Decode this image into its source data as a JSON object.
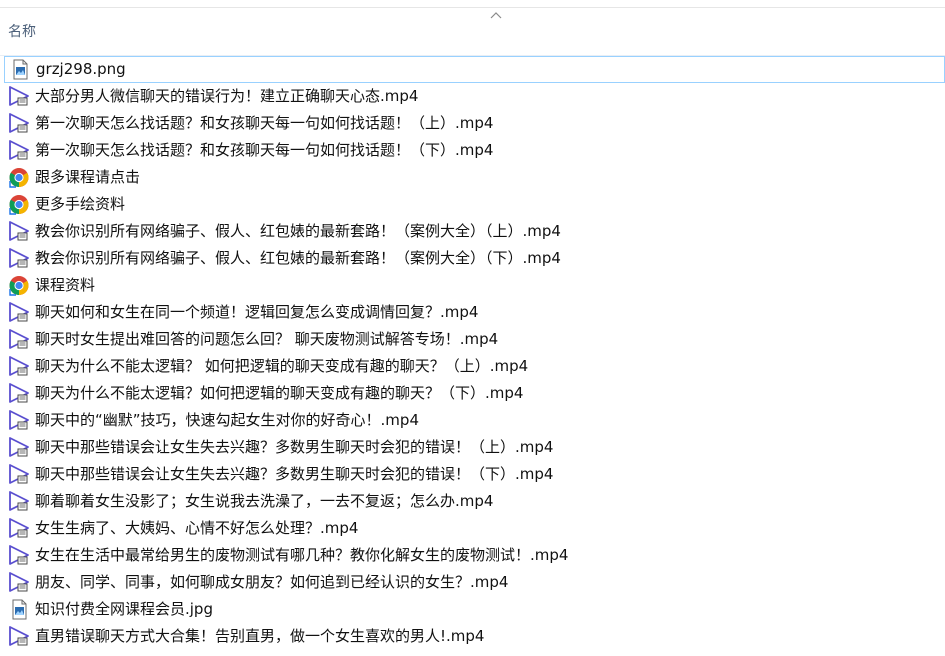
{
  "header": {
    "column_name": "名称"
  },
  "colors": {
    "header_text": "#4c607a",
    "focus_border": "#99d1ff",
    "media_icon": "#5a4fcf",
    "doc_icon_accent": "#2b6cb0"
  },
  "files": [
    {
      "name": "grzj298.png",
      "icon": "image-file-icon",
      "focused": true
    },
    {
      "name": "大部分男人微信聊天的错误行为！建立正确聊天心态.mp4",
      "icon": "video-file-icon"
    },
    {
      "name": "第一次聊天怎么找话题？和女孩聊天每一句如何找话题！（上）.mp4",
      "icon": "video-file-icon"
    },
    {
      "name": "第一次聊天怎么找话题？和女孩聊天每一句如何找话题！（下）.mp4",
      "icon": "video-file-icon"
    },
    {
      "name": "跟多课程请点击",
      "icon": "chrome-link-icon"
    },
    {
      "name": "更多手绘资料",
      "icon": "chrome-link-icon"
    },
    {
      "name": "教会你识别所有网络骗子、假人、红包婊的最新套路！（案例大全）（上）.mp4",
      "icon": "video-file-icon"
    },
    {
      "name": "教会你识别所有网络骗子、假人、红包婊的最新套路！（案例大全）（下）.mp4",
      "icon": "video-file-icon"
    },
    {
      "name": "课程资料",
      "icon": "chrome-link-icon"
    },
    {
      "name": "聊天如何和女生在同一个频道！逻辑回复怎么变成调情回复？.mp4",
      "icon": "video-file-icon"
    },
    {
      "name": "聊天时女生提出难回答的问题怎么回？ 聊天废物测试解答专场！.mp4",
      "icon": "video-file-icon"
    },
    {
      "name": "聊天为什么不能太逻辑？ 如何把逻辑的聊天变成有趣的聊天？（上）.mp4",
      "icon": "video-file-icon"
    },
    {
      "name": "聊天为什么不能太逻辑？如何把逻辑的聊天变成有趣的聊天？（下）.mp4",
      "icon": "video-file-icon"
    },
    {
      "name": "聊天中的“幽默”技巧，快速勾起女生对你的好奇心！.mp4",
      "icon": "video-file-icon"
    },
    {
      "name": "聊天中那些错误会让女生失去兴趣？多数男生聊天时会犯的错误！（上）.mp4",
      "icon": "video-file-icon"
    },
    {
      "name": "聊天中那些错误会让女生失去兴趣？多数男生聊天时会犯的错误！（下）.mp4",
      "icon": "video-file-icon"
    },
    {
      "name": "聊着聊着女生没影了；女生说我去洗澡了，一去不复返；怎么办.mp4",
      "icon": "video-file-icon"
    },
    {
      "name": "女生生病了、大姨妈、心情不好怎么处理？.mp4",
      "icon": "video-file-icon"
    },
    {
      "name": "女生在生活中最常给男生的废物测试有哪几种？教你化解女生的废物测试！.mp4",
      "icon": "video-file-icon"
    },
    {
      "name": "朋友、同学、同事，如何聊成女朋友？如何追到已经认识的女生？.mp4",
      "icon": "video-file-icon"
    },
    {
      "name": "知识付费全网课程会员.jpg",
      "icon": "image-file-icon"
    },
    {
      "name": "直男错误聊天方式大合集！告别直男，做一个女生喜欢的男人!.mp4",
      "icon": "video-file-icon"
    }
  ]
}
